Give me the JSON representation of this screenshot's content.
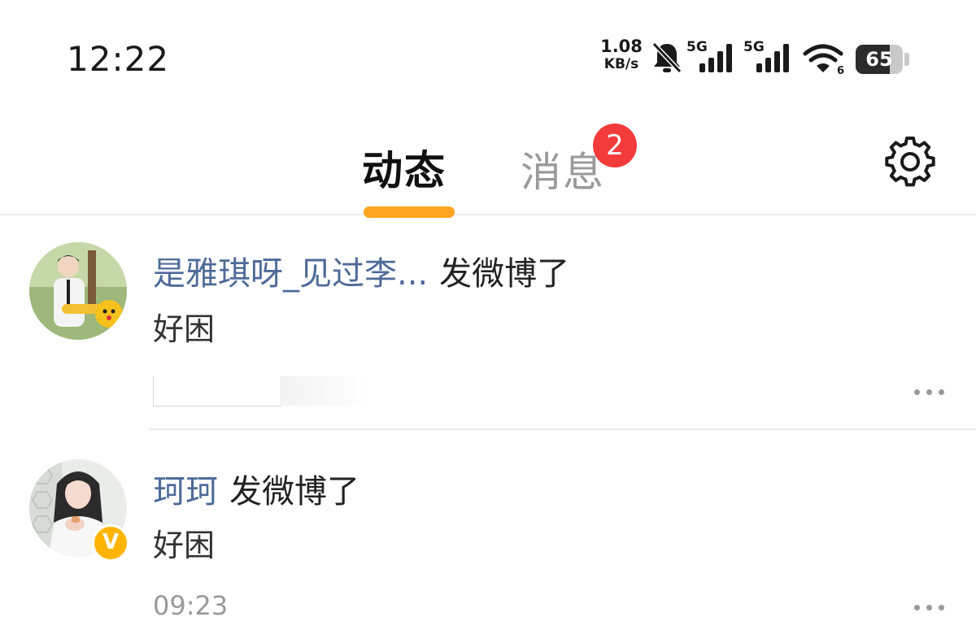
{
  "status_bar": {
    "time": "12:22",
    "net_speed_value": "1.08",
    "net_speed_unit": "KB/s",
    "network1": "5G",
    "network2": "5G",
    "battery": "65",
    "icons": [
      "bell-off-icon",
      "signal-5g-icon",
      "signal-5g-icon",
      "wifi-icon",
      "battery-icon"
    ]
  },
  "header": {
    "tabs": [
      {
        "label": "动态",
        "active": true
      },
      {
        "label": "消息",
        "active": false,
        "badge": "2"
      }
    ],
    "settings_icon": "gear-icon",
    "accent_color": "#ffa51f",
    "badge_color": "#f43b3b"
  },
  "feed": [
    {
      "user": "是雅琪呀_见过李...",
      "action": "发微博了",
      "text": "好困",
      "avatar_icon": "avatar-photo",
      "more_icon": "more-icon"
    },
    {
      "user": "珂珂",
      "action": "发微博了",
      "text": "好困",
      "time": "09:23",
      "verified": "V",
      "avatar_icon": "avatar-photo",
      "more_icon": "more-icon"
    }
  ],
  "colors": {
    "username": "#4e6a99",
    "secondary_text": "#999999"
  }
}
